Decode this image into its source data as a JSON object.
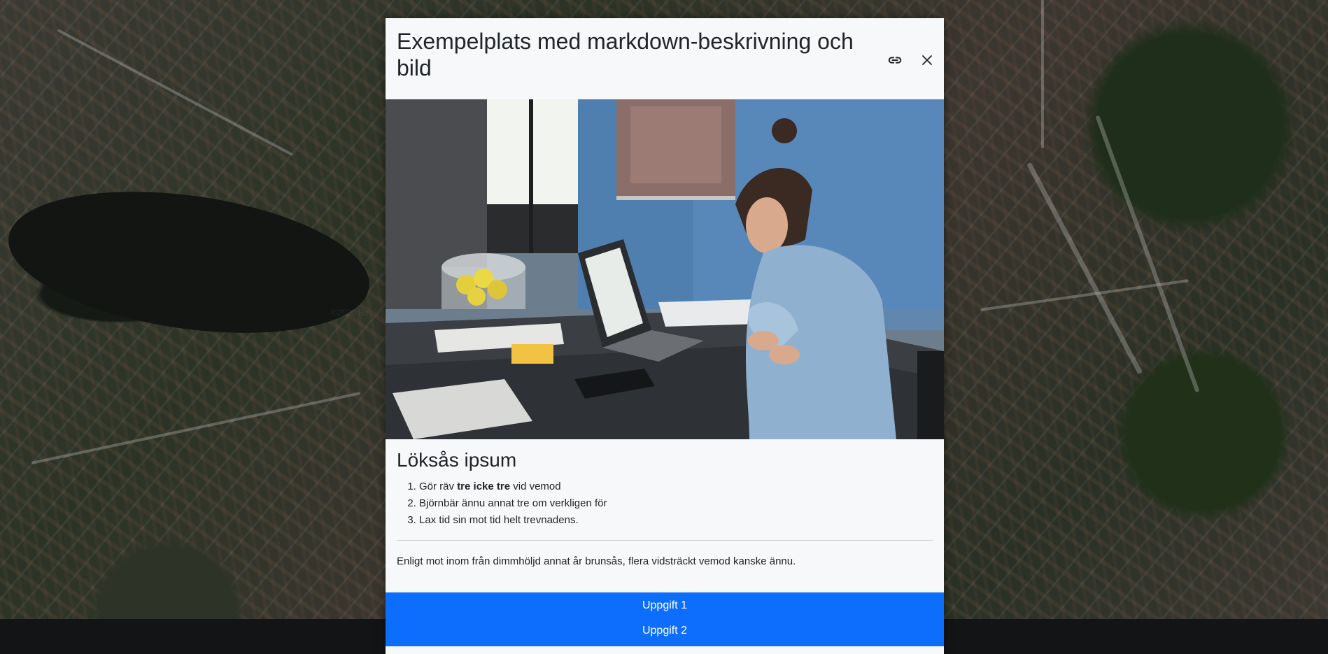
{
  "map": {
    "attribution": "©2020 Be"
  },
  "modal": {
    "title": "Exempelplats med markdown-beskrivning och bild",
    "link_icon": "link-icon",
    "close_icon": "close-icon",
    "image": "woman-working-at-laptop-photo",
    "heading": "Löksås ipsum",
    "list": [
      {
        "prefix": "Gör räv ",
        "bold": "tre icke tre",
        "suffix": " vid vemod"
      },
      {
        "text": "Björnbär ännu annat tre om verkligen för"
      },
      {
        "text": "Lax tid sin mot tid helt trevnadens."
      }
    ],
    "paragraph": "Enligt mot inom från dimmhöljd annat år brunsås, flera vidsträckt vemod kanske ännu.",
    "buttons": [
      "Uppgift 1",
      "Uppgift 2"
    ]
  },
  "colors": {
    "accent": "#0d6efd",
    "modal_bg": "#f7f8f9",
    "bottom_bar": "#121416"
  }
}
